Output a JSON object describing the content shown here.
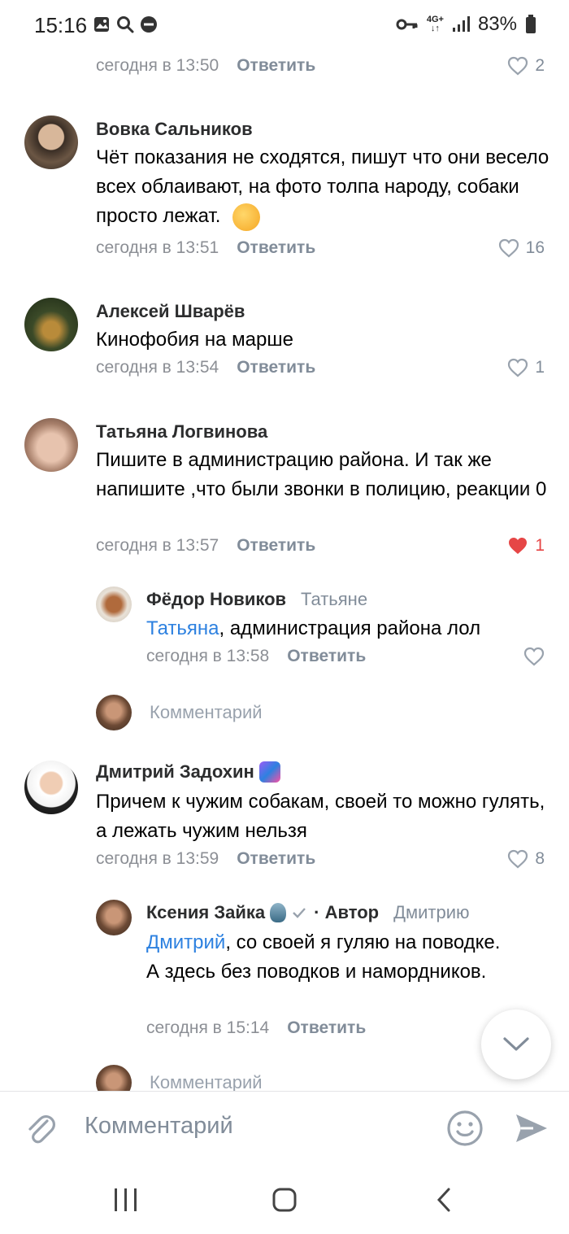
{
  "status_bar": {
    "time": "15:16",
    "network": "4G+",
    "battery": "83%"
  },
  "comments": [
    {
      "meta": {
        "time": "сегодня в 13:50",
        "reply": "Ответить",
        "likes": "2",
        "liked": false
      }
    },
    {
      "author": "Вовка Сальников",
      "text": "Чёт показания не сходятся, пишут что они весело всех облаивают, на фото толпа народу, собаки просто лежат.",
      "emoji": "🤔",
      "meta": {
        "time": "сегодня в 13:51",
        "reply": "Ответить",
        "likes": "16",
        "liked": false
      }
    },
    {
      "author": "Алексей Шварёв",
      "text": "Кинофобия на марше",
      "meta": {
        "time": "сегодня в 13:54",
        "reply": "Ответить",
        "likes": "1",
        "liked": false
      }
    },
    {
      "author": "Татьяна Логвинова",
      "text": "Пишите в администрацию района. И так же напишите ,что были звонки в полицию, реакции 0",
      "meta": {
        "time": "сегодня в 13:57",
        "reply": "Ответить",
        "likes": "1",
        "liked": true
      }
    },
    {
      "author": "Фёдор Новиков",
      "to_whom": "Татьяне",
      "mention": "Татьяна",
      "text": ", администрация района лол",
      "meta": {
        "time": "сегодня в 13:58",
        "reply": "Ответить",
        "likes": "",
        "liked": false
      }
    },
    {
      "author": "Дмитрий Задохин",
      "text": "Причем к чужим собакам, своей то можно гулять, а лежать чужим нельзя",
      "meta": {
        "time": "сегодня в 13:59",
        "reply": "Ответить",
        "likes": "8",
        "liked": false
      }
    },
    {
      "author": "Ксения Зайка",
      "author_suffix": "· Автор",
      "to_whom": "Дмитрию",
      "mention": "Дмитрий",
      "text": ", со своей я гуляю на поводке. А здесь без поводков и намордников.",
      "meta": {
        "time": "сегодня в 15:14",
        "reply": "Ответить"
      }
    }
  ],
  "reply_fields": [
    {
      "placeholder": "Комментарий"
    },
    {
      "placeholder": "Комментарий"
    }
  ],
  "composer": {
    "placeholder": "Комментарий"
  },
  "colors": {
    "accent": "#2d81e0",
    "like_red": "#e64646",
    "secondary": "#818c99"
  },
  "icons": [
    "key-icon",
    "signal-icon",
    "battery-icon",
    "heart-icon",
    "heart-filled-icon",
    "clip-icon",
    "smile-icon",
    "send-icon",
    "chevron-down-icon"
  ]
}
